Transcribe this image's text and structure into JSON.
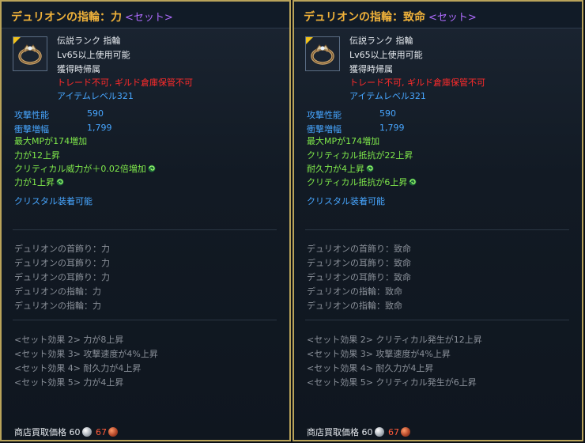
{
  "left": {
    "title": "デュリオンの指輪：力",
    "set_tag": "<セット>",
    "item_icon": "ring-icon",
    "grade": "伝説ランク 指輪",
    "level_req": "Lv65以上使用可能",
    "bind": "獲得時帰属",
    "restriction": "トレード不可, ギルド倉庫保管不可",
    "item_level": "アイテムレベル321",
    "stats": [
      {
        "label": "攻撃性能",
        "value": "590"
      },
      {
        "label": "衝撃増幅",
        "value": "1,799"
      }
    ],
    "bonuses": [
      {
        "text": "最大MPが174増加",
        "enchant_icon": false
      },
      {
        "text": "力が12上昇",
        "enchant_icon": false
      },
      {
        "text": "クリティカル威力が＋0.02倍増加",
        "enchant_icon": true
      },
      {
        "text": "力が1上昇",
        "enchant_icon": true
      }
    ],
    "crystal": "クリスタル装着可能",
    "set_items": [
      "デュリオンの首飾り：力",
      "デュリオンの耳飾り：力",
      "デュリオンの耳飾り：力",
      "デュリオンの指輪：力",
      "デュリオンの指輪：力"
    ],
    "set_effects": [
      "<セット効果 2> 力が8上昇",
      "<セット効果 3> 攻撃速度が4%上昇",
      "<セット効果 4> 耐久力が4上昇",
      "<セット効果 5> 力が4上昇"
    ],
    "price_label": "商店買取価格",
    "price_silver": "60",
    "price_copper": "67"
  },
  "right": {
    "title": "デュリオンの指輪：致命",
    "set_tag": "<セット>",
    "item_icon": "ring-icon",
    "grade": "伝説ランク 指輪",
    "level_req": "Lv65以上使用可能",
    "bind": "獲得時帰属",
    "restriction": "トレード不可, ギルド倉庫保管不可",
    "item_level": "アイテムレベル321",
    "stats": [
      {
        "label": "攻撃性能",
        "value": "590"
      },
      {
        "label": "衝撃増幅",
        "value": "1,799"
      }
    ],
    "bonuses": [
      {
        "text": "最大MPが174増加",
        "enchant_icon": false
      },
      {
        "text": "クリティカル抵抗が22上昇",
        "enchant_icon": false
      },
      {
        "text": "耐久力が4上昇",
        "enchant_icon": true
      },
      {
        "text": "クリティカル抵抗が6上昇",
        "enchant_icon": true
      }
    ],
    "crystal": "クリスタル装着可能",
    "set_items": [
      "デュリオンの首飾り：致命",
      "デュリオンの耳飾り：致命",
      "デュリオンの耳飾り：致命",
      "デュリオンの指輪：致命",
      "デュリオンの指輪：致命"
    ],
    "set_effects": [
      "<セット効果 2> クリティカル発生が12上昇",
      "<セット効果 3> 攻撃速度が4%上昇",
      "<セット効果 4> 耐久力が4上昇",
      "<セット効果 5> クリティカル発生が6上昇"
    ],
    "price_label": "商店買取価格",
    "price_silver": "60",
    "price_copper": "67"
  },
  "colors": {
    "title": "#f0b23a",
    "set_tag": "#b06cff",
    "restriction": "#ff2b2b",
    "info_blue": "#47a6ff",
    "bonus_green": "#7fe84a",
    "inactive_gray": "#8a9099",
    "border_gold": "#b9a35a"
  }
}
